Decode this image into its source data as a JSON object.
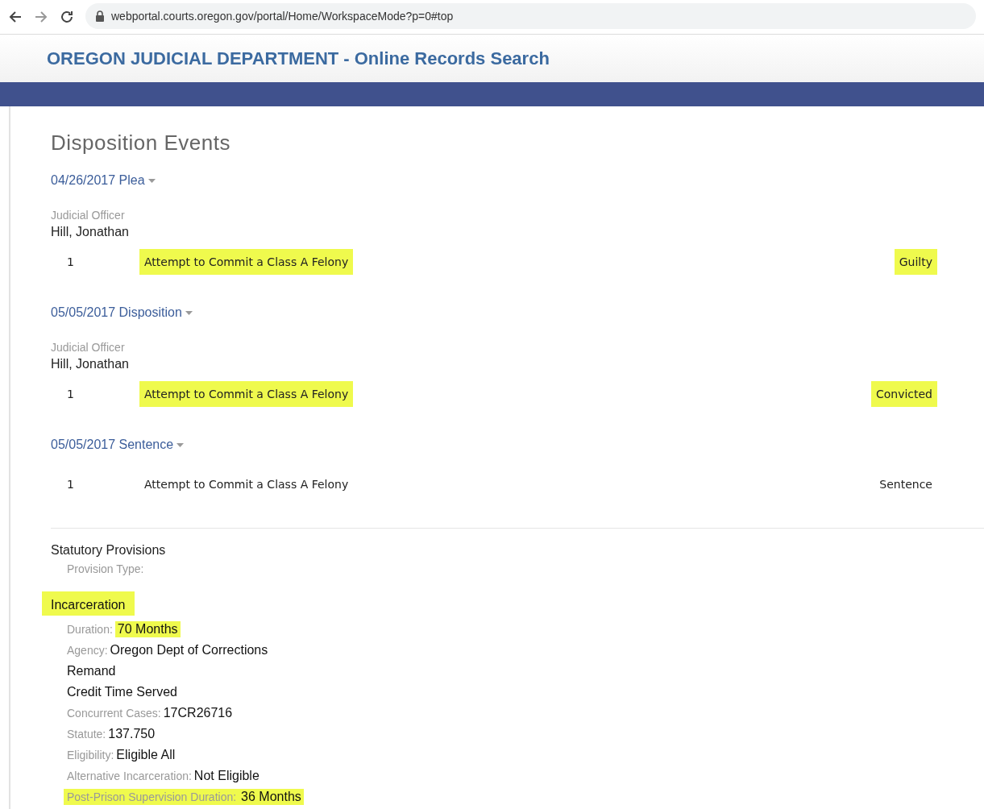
{
  "browser": {
    "url": "webportal.courts.oregon.gov/portal/Home/WorkspaceMode?p=0#top"
  },
  "header": {
    "title": "OREGON JUDICIAL DEPARTMENT - Online Records Search"
  },
  "section": {
    "title": "Disposition Events"
  },
  "events": [
    {
      "heading": "04/26/2017 Plea",
      "officer_label": "Judicial Officer",
      "officer": "Hill, Jonathan",
      "charges": [
        {
          "number": "1",
          "description": "Attempt to Commit a Class A Felony",
          "description_highlighted": true,
          "outcome": "Guilty",
          "outcome_highlighted": true
        }
      ]
    },
    {
      "heading": "05/05/2017 Disposition",
      "officer_label": "Judicial Officer",
      "officer": "Hill, Jonathan",
      "charges": [
        {
          "number": "1",
          "description": "Attempt to Commit a Class A Felony",
          "description_highlighted": true,
          "outcome": "Convicted",
          "outcome_highlighted": true
        }
      ]
    },
    {
      "heading": "05/05/2017 Sentence",
      "charges": [
        {
          "number": "1",
          "description": "Attempt to Commit a Class A Felony",
          "description_highlighted": false,
          "outcome": "Sentence",
          "outcome_highlighted": false
        }
      ]
    }
  ],
  "provisions": {
    "title": "Statutory Provisions",
    "type_label": "Provision Type:",
    "type": "Incarceration",
    "type_highlighted": true,
    "details": [
      {
        "label": "Duration:",
        "value": "70 Months",
        "label_highlighted": false,
        "value_highlighted": true
      },
      {
        "label": "Agency:",
        "value": "Oregon Dept of Corrections",
        "label_highlighted": false,
        "value_highlighted": false
      },
      {
        "value": "Remand",
        "value_highlighted": false
      },
      {
        "value": "Credit Time Served",
        "value_highlighted": false
      },
      {
        "label": "Concurrent Cases:",
        "value": "17CR26716",
        "label_highlighted": false,
        "value_highlighted": false
      },
      {
        "label": "Statute:",
        "value": "137.750",
        "label_highlighted": false,
        "value_highlighted": false
      },
      {
        "label": "Eligibility:",
        "value": "Eligible All",
        "label_highlighted": false,
        "value_highlighted": false
      },
      {
        "label": "Alternative Incarceration:",
        "value": "Not Eligible",
        "label_highlighted": false,
        "value_highlighted": false
      },
      {
        "label": "Post-Prison Supervision Duration:",
        "value": "36 Months",
        "label_highlighted": true,
        "value_highlighted": true
      }
    ]
  }
}
